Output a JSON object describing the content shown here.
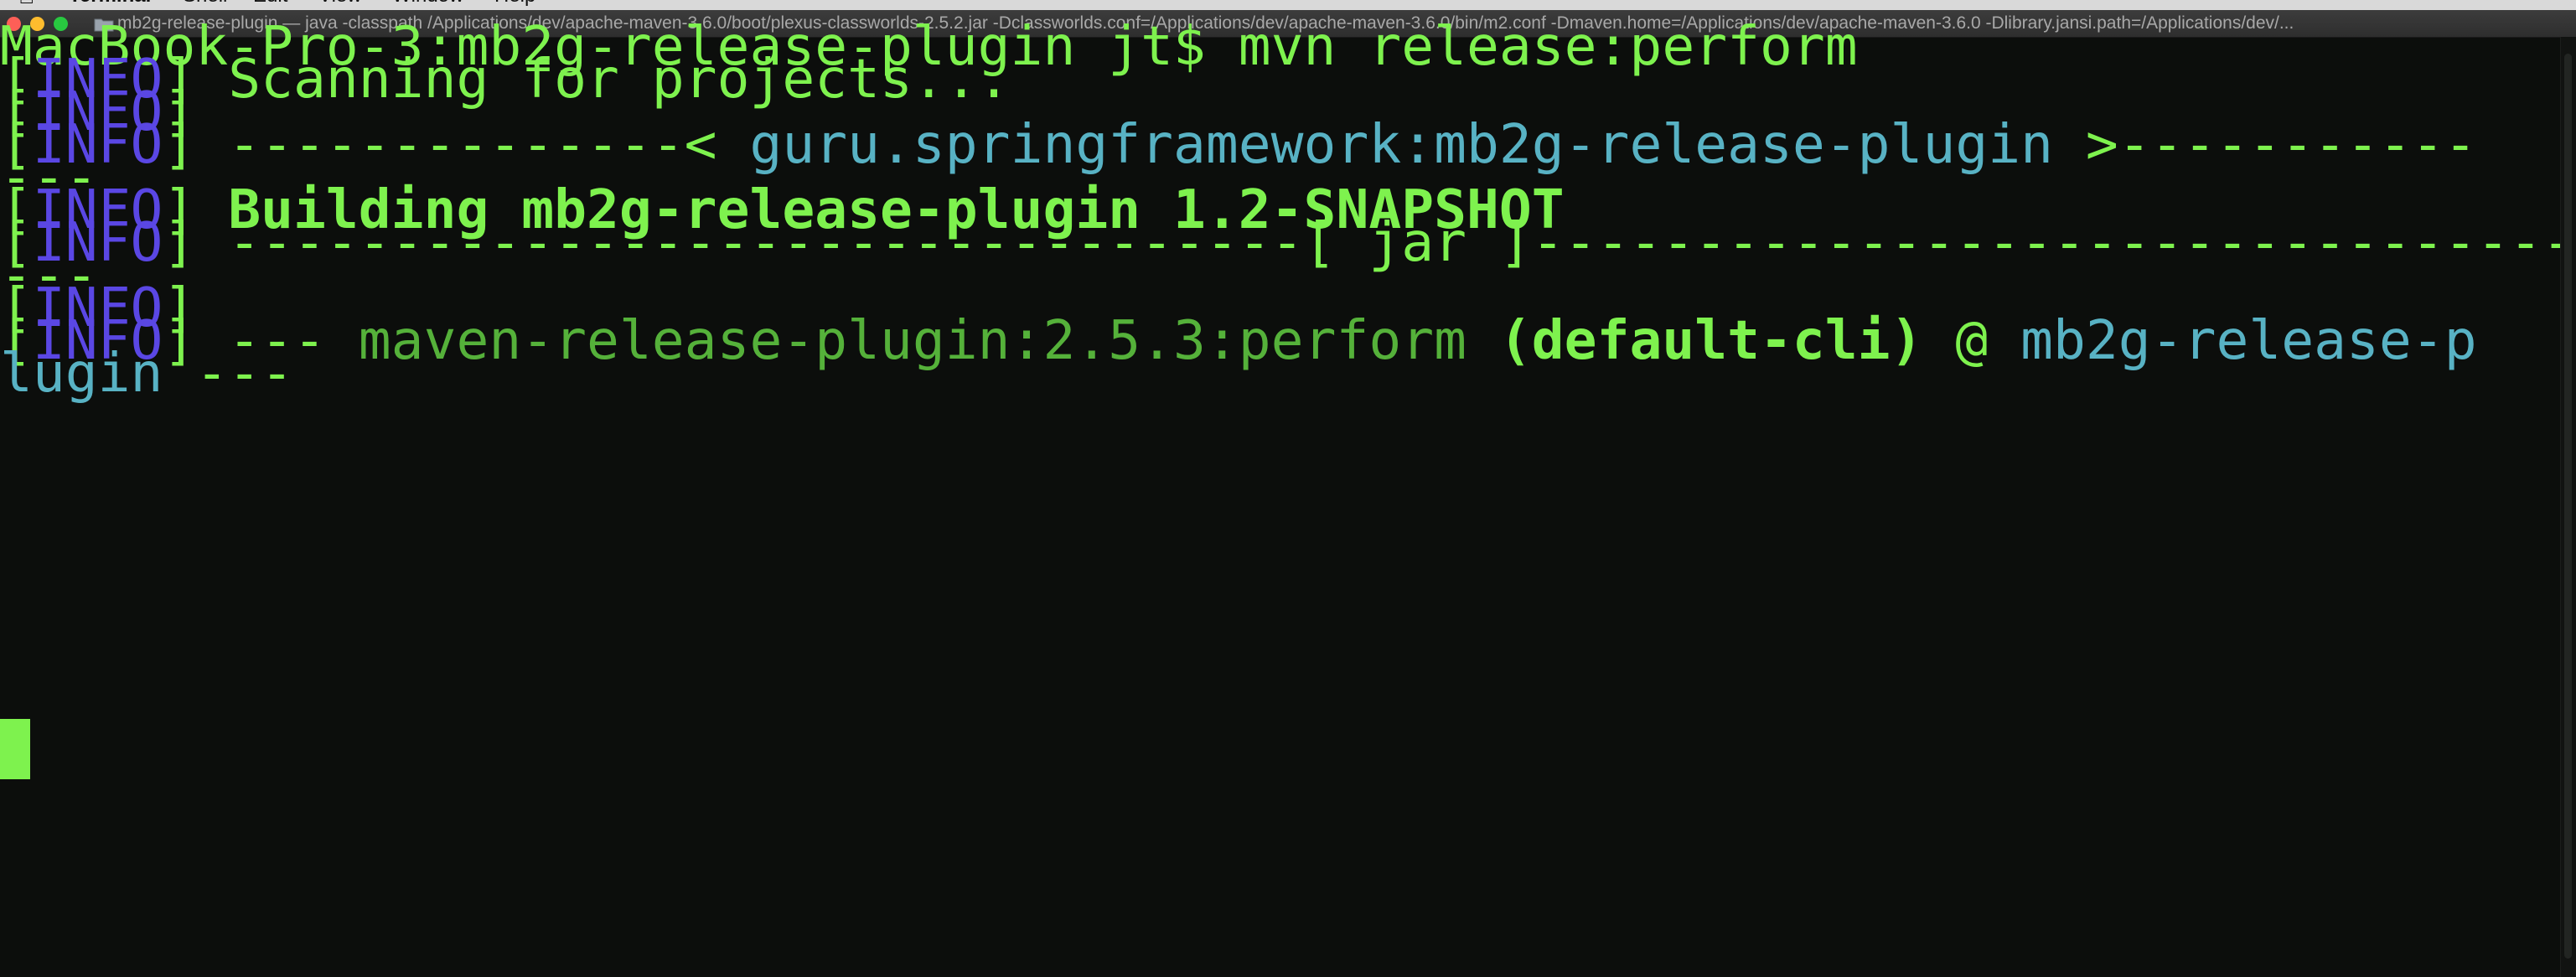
{
  "menubar": {
    "app_name": "Terminal",
    "items": [
      "Shell",
      "Edit",
      "View",
      "Window",
      "Help"
    ]
  },
  "window": {
    "title": "mb2g-release-plugin — java -classpath /Applications/dev/apache-maven-3.6.0/boot/plexus-classworlds-2.5.2.jar -Dclassworlds.conf=/Applications/dev/apache-maven-3.6.0/bin/m2.conf -Dmaven.home=/Applications/dev/apache-maven-3.6.0 -Dlibrary.jansi.path=/Applications/dev/..."
  },
  "terminal": {
    "prompt": "MacBook-Pro-3:mb2g-release-plugin jt$ mvn release:perform",
    "lines": {
      "l1_rest": " Scanning for projects...",
      "l3_prefix": " --------------< ",
      "l3_artifact": "guru.springframework:mb2g-release-plugin",
      "l3_suffix": " >-----------",
      "l4": "---",
      "l5_rest": " Building mb2g-release-plugin 1.2-SNAPSHOT",
      "l6_rest": " ---------------------------------[ jar ]--------------------------------",
      "l7": "---",
      "l9_dashes_a": " --- ",
      "l9_plugin": "maven-release-plugin:2.5.3:perform",
      "l9_exec": " (default-cli)",
      "l9_at": " @ ",
      "l9_project": "mb2g-release-p",
      "l10_project": "lugin",
      "l10_dashes": " ---"
    },
    "info_open": "[",
    "info_word": "INFO",
    "info_close": "]"
  },
  "colors": {
    "background": "#0c0e0c",
    "green": "#7ef24e",
    "info_blue": "#5a47e4",
    "cyan": "#58b2c4",
    "dark_green": "#55b13a"
  }
}
